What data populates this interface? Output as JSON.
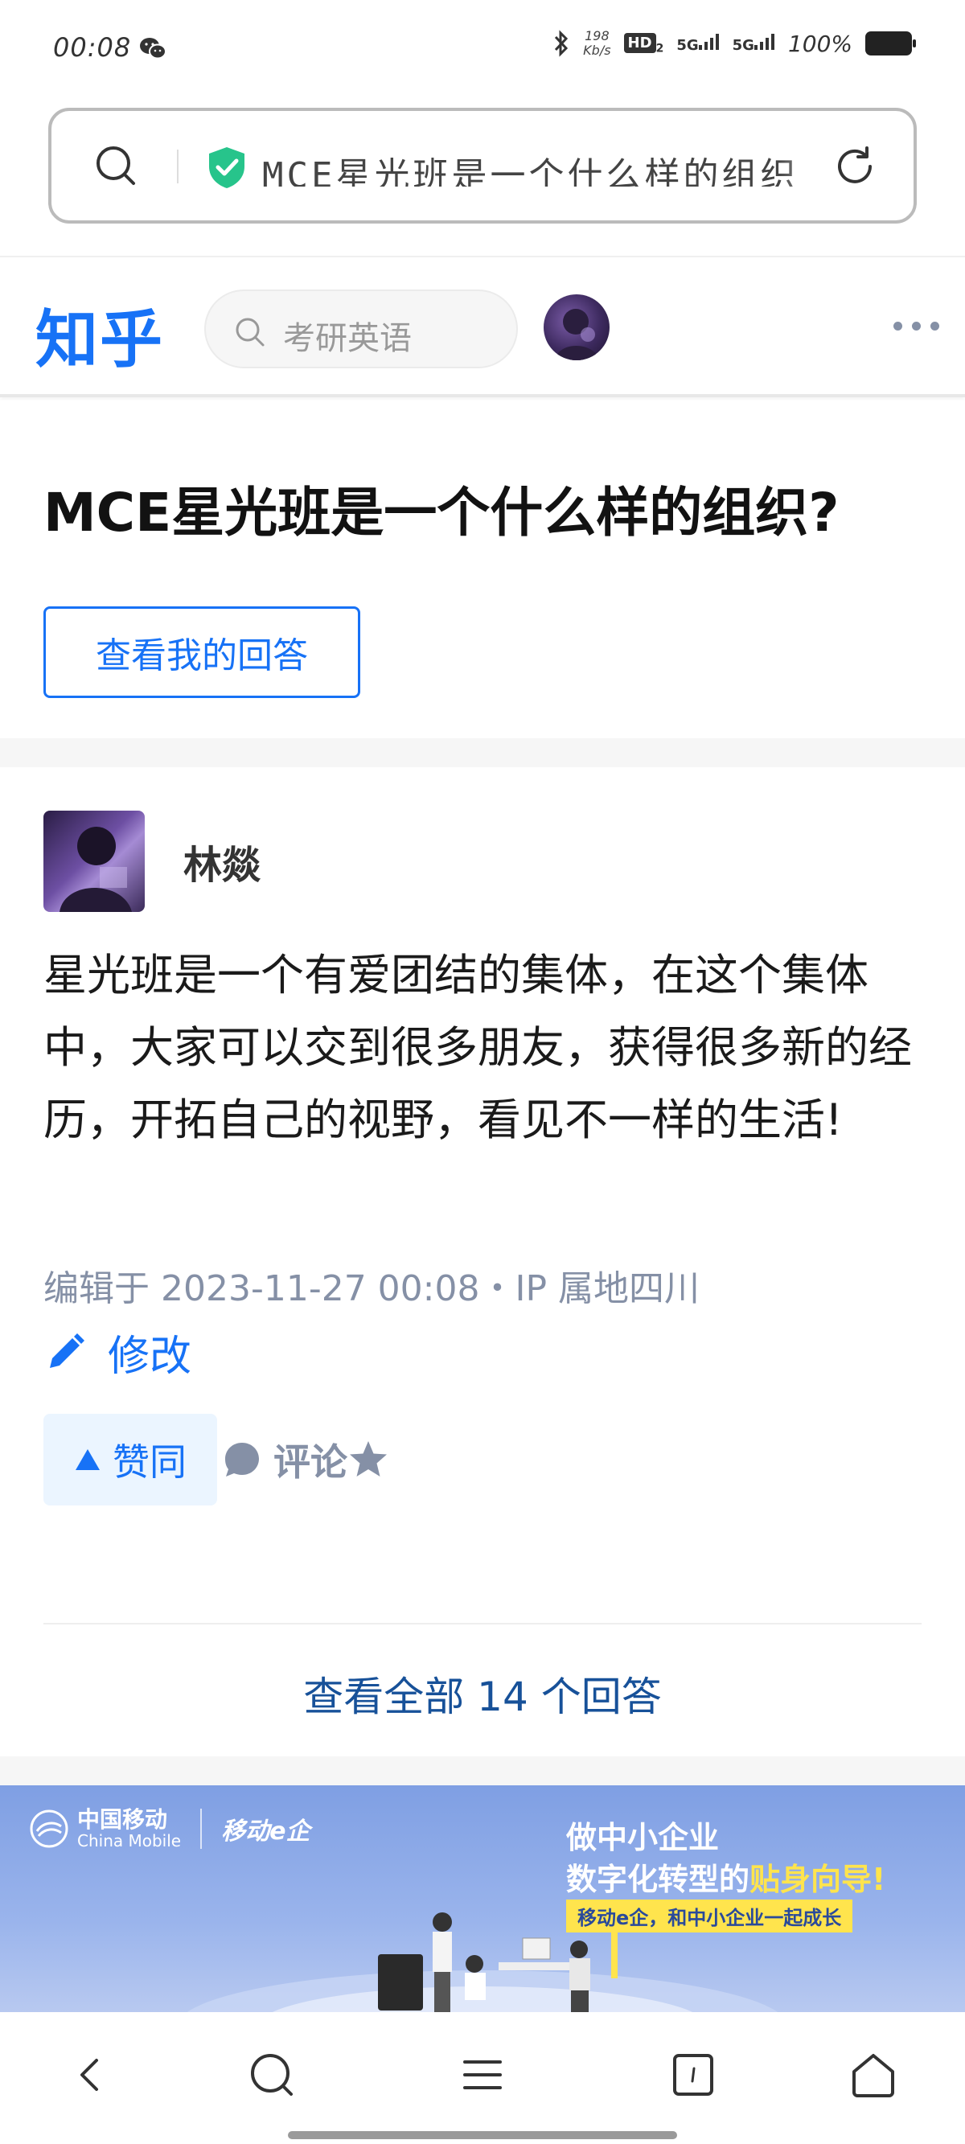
{
  "status_bar": {
    "time": "00:08",
    "speed_value": "198",
    "speed_unit": "Kb/s",
    "hd_label": "HD",
    "hd_sub": "2",
    "signal1": "5G",
    "signal2": "5G",
    "battery": "100%"
  },
  "browser": {
    "url_text": "MCE星光班是一个什么样的组织"
  },
  "zhihu": {
    "logo": "知乎",
    "search_placeholder": "考研英语"
  },
  "question": {
    "title": "MCE星光班是一个什么样的组织?",
    "my_answer_label": "查看我的回答"
  },
  "answer": {
    "author": "林燚",
    "content": "星光班是一个有爱团结的集体，在这个集体中，大家可以交到很多朋友，获得很多新的经历，开拓自己的视野，看见不一样的生活!",
    "meta": "编辑于 2023-11-27 00:08・IP 属地四川",
    "edit_label": "修改",
    "vote_label": "赞同",
    "comment_label": "评论",
    "view_all_label": "查看全部 14 个回答"
  },
  "ad": {
    "logo_cn": "中国移动",
    "logo_en": "China Mobile",
    "brand": "移动e企",
    "line1": "做中小企业",
    "line2_prefix": "数字化转型的",
    "line2_highlight": "贴身向导!",
    "tag": "移动e企，和中小企业一起成长"
  },
  "colors": {
    "zhihu_blue": "#1772f6",
    "link_blue": "#175199",
    "meta_gray": "#8590a6",
    "vote_bg": "#ebf5ff"
  }
}
